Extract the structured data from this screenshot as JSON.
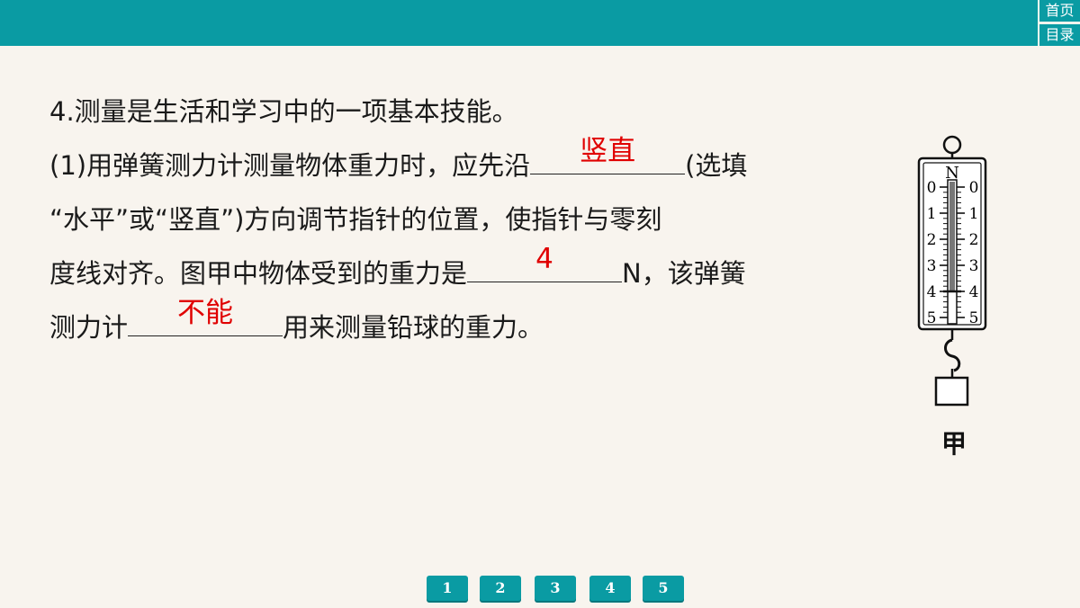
{
  "nav": {
    "home": "首页",
    "toc": "目录"
  },
  "question": {
    "line1": "4.测量是生活和学习中的一项基本技能。",
    "line2_pre": "(1)用弹簧测力计测量物体重力时，应先沿",
    "answer1": "竖直",
    "line2_post": "(选填",
    "line3": "“水平”或“竖直”)方向调节指针的位置，使指针与零刻",
    "line4_pre": "度线对齐。图甲中物体受到的重力是",
    "answer2": "4",
    "line4_post": "N，该弹簧",
    "line5_pre": "测力计",
    "answer3": "不能",
    "line5_post": "用来测量铅球的重力。"
  },
  "figure": {
    "unit": "N",
    "left_ticks": [
      "0",
      "1",
      "2",
      "3",
      "4",
      "5"
    ],
    "right_ticks": [
      "0",
      "1",
      "2",
      "3",
      "4",
      "5"
    ],
    "reading": 4,
    "caption": "甲"
  },
  "pager": [
    "1",
    "2",
    "3",
    "4",
    "5"
  ],
  "colors": {
    "accent": "#0a9ba3",
    "answer": "#e00000"
  }
}
